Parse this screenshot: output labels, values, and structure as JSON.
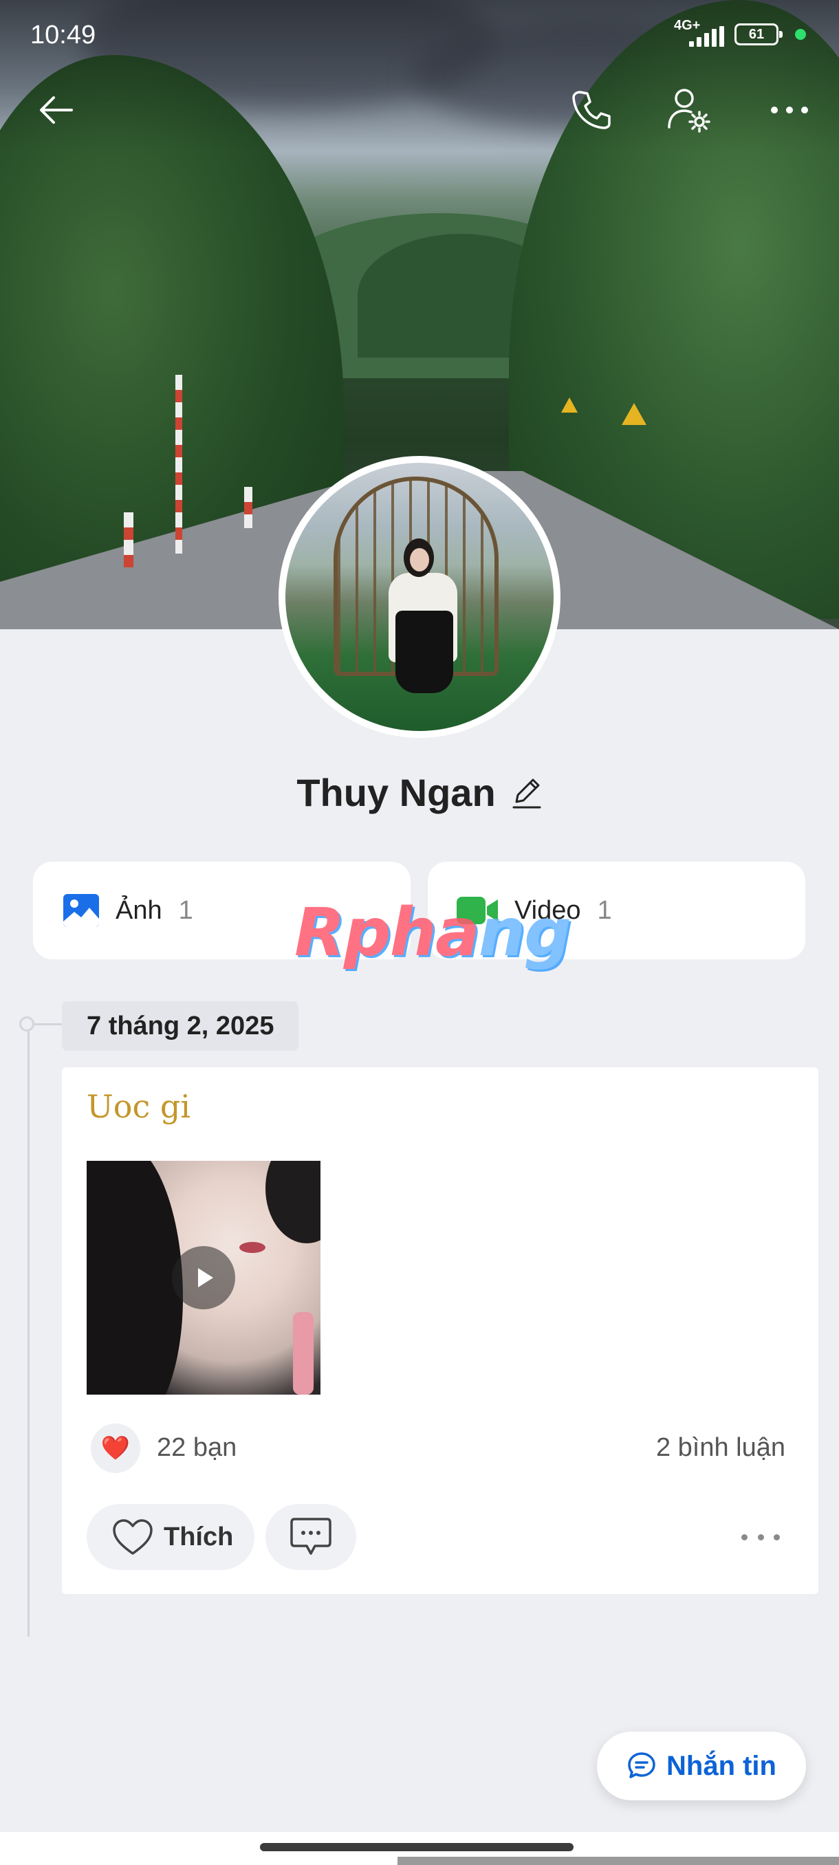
{
  "status_bar": {
    "time": "10:49",
    "network": "4G+",
    "battery": "61"
  },
  "top_nav": {
    "back_icon": "arrow-left-icon",
    "call_icon": "phone-icon",
    "profile_settings_icon": "person-gear-icon",
    "more_icon": "more-horizontal-icon"
  },
  "profile": {
    "name": "Thuy Ngan",
    "edit_icon": "pencil-icon"
  },
  "media": {
    "photos": {
      "label": "Ảnh",
      "count": "1",
      "icon": "image-icon",
      "color": "#1a6fe8"
    },
    "videos": {
      "label": "Video",
      "count": "1",
      "icon": "video-camera-icon",
      "color": "#2fb34a"
    }
  },
  "watermark": {
    "text_a": "Rpha",
    "text_b": "ng"
  },
  "timeline": {
    "date": "7 tháng 2, 2025",
    "post": {
      "title": "Uoc gi",
      "reaction_emoji": "❤️",
      "reaction_count": "22 bạn",
      "comment_count": "2 bình luận",
      "like_label": "Thích"
    }
  },
  "fab": {
    "label": "Nhắn tin",
    "icon": "chat-bubble-icon",
    "color": "#0d63d6"
  }
}
